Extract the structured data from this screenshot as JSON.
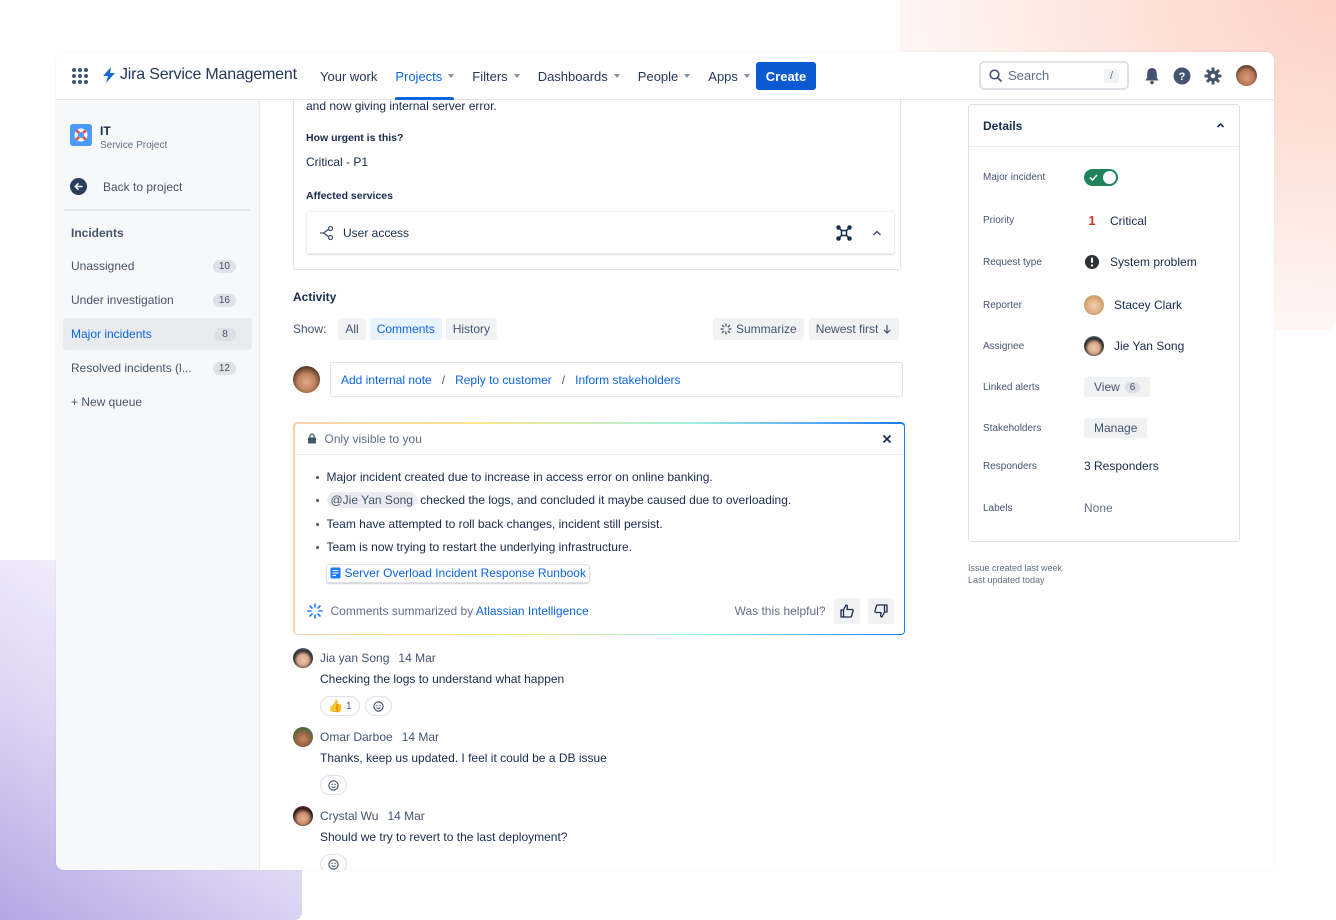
{
  "app": {
    "title": "Jira Service Management",
    "accent": "#0c66e4"
  },
  "topnav": {
    "items": [
      {
        "label": "Your work",
        "dropdown": false,
        "active": false
      },
      {
        "label": "Projects",
        "dropdown": true,
        "active": true
      },
      {
        "label": "Filters",
        "dropdown": true,
        "active": false
      },
      {
        "label": "Dashboards",
        "dropdown": true,
        "active": false
      },
      {
        "label": "People",
        "dropdown": true,
        "active": false
      },
      {
        "label": "Apps",
        "dropdown": true,
        "active": false
      }
    ],
    "create_label": "Create",
    "search_placeholder": "Search",
    "search_shortcut": "/",
    "icons": [
      "bell-icon",
      "help-icon",
      "settings-icon",
      "user-avatar"
    ]
  },
  "sidebar": {
    "project_name": "IT",
    "project_type": "Service Project",
    "back_label": "Back to project",
    "section_heading": "Incidents",
    "queues": [
      {
        "label": "Unassigned",
        "count": "10",
        "active": false
      },
      {
        "label": "Under investigation",
        "count": "16",
        "active": false
      },
      {
        "label": "Major incidents",
        "count": "8",
        "active": true
      },
      {
        "label": "Resolved incidents (l...",
        "count": "12",
        "active": false
      }
    ],
    "new_queue_label": "+ New queue"
  },
  "issue": {
    "description_tail": "and now giving internal server error.",
    "urgency_label": "How urgent is this?",
    "urgency_value": "Critical - P1",
    "affected_label": "Affected services",
    "affected_service": "User access"
  },
  "activity": {
    "heading": "Activity",
    "show_label": "Show:",
    "filters": [
      {
        "label": "All",
        "selected": false
      },
      {
        "label": "Comments",
        "selected": true
      },
      {
        "label": "History",
        "selected": false
      }
    ],
    "summarize_label": "Summarize",
    "sort_label": "Newest first",
    "compose_actions": [
      "Add internal note",
      "Reply to customer",
      "Inform stakeholders"
    ],
    "compose_sep": "/"
  },
  "ai_summary": {
    "visibility": "Only visible to you",
    "bullets": [
      {
        "mention": "",
        "text": "Major incident created due to increase in access error on online banking."
      },
      {
        "mention": "@Jie Yan Song",
        "text": " checked the logs, and concluded it maybe caused due to overloading."
      },
      {
        "mention": "",
        "text": "Team have attempted to roll back changes, incident still persist."
      },
      {
        "mention": "",
        "text": "Team is now trying to restart the underlying infrastructure."
      }
    ],
    "runbook_link": "Server Overload Incident Response Runbook",
    "footer_prefix": "Comments summarized by ",
    "footer_link": "Atlassian Intelligence",
    "helpful_question": "Was this helpful?"
  },
  "comments": [
    {
      "author": "Jia yan Song",
      "date": "14 Mar",
      "body": "Checking the logs to understand what happen",
      "reactions": [
        {
          "emoji": "thumbs-up",
          "count": "1"
        }
      ],
      "avatar_color": "#8fb3d9"
    },
    {
      "author": "Omar Darboe",
      "date": "14 Mar",
      "body": "Thanks, keep us updated. I feel it could be a DB issue",
      "reactions": [],
      "avatar_color": "#2e6b3a"
    },
    {
      "author": "Crystal Wu",
      "date": "14 Mar",
      "body": "Should we try to revert to the last deployment?",
      "reactions": [],
      "avatar_color": "#d9486a"
    }
  ],
  "details": {
    "title": "Details",
    "rows": {
      "major_incident": {
        "label": "Major incident",
        "value": true
      },
      "priority": {
        "label": "Priority",
        "value": "Critical",
        "icon_text": "1",
        "icon_color": "#ca3521"
      },
      "request_type": {
        "label": "Request type",
        "value": "System problem"
      },
      "reporter": {
        "label": "Reporter",
        "value": "Stacey Clark"
      },
      "assignee": {
        "label": "Assignee",
        "value": "Jie Yan Song"
      },
      "linked_alerts": {
        "label": "Linked alerts",
        "button": "View",
        "count": "6"
      },
      "stakeholders": {
        "label": "Stakeholders",
        "button": "Manage"
      },
      "responders": {
        "label": "Responders",
        "value": "3 Responders"
      },
      "labels": {
        "label": "Labels",
        "value": "None"
      }
    },
    "created": "Issue created last week",
    "updated": "Last updated today"
  }
}
